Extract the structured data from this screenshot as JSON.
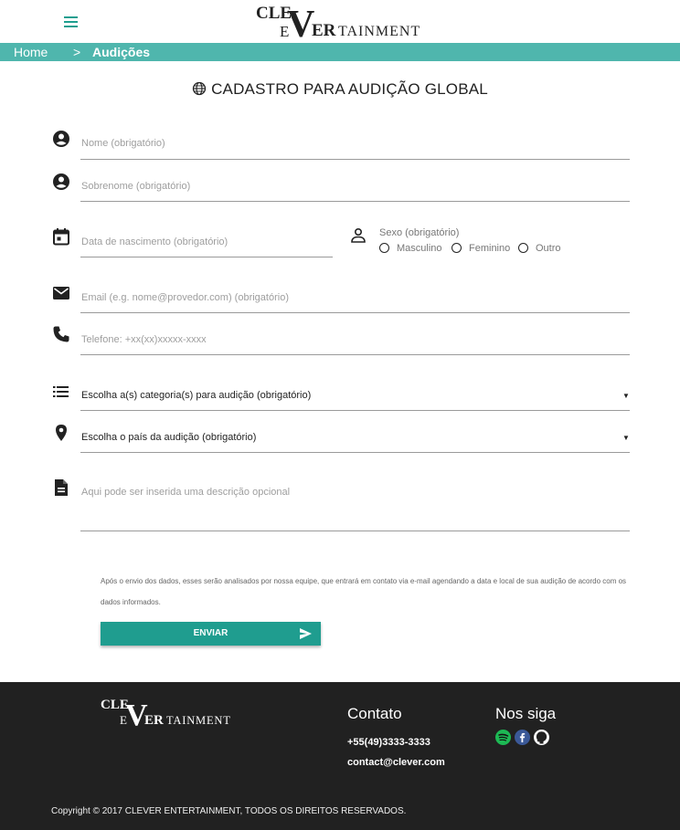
{
  "header": {
    "brand_top": "CLE",
    "brand_v": "V",
    "brand_e": "E",
    "brand_er": "ER",
    "brand_rest": "TAINMENT"
  },
  "breadcrumb": {
    "home": "Home",
    "separator": ">",
    "current": "Audições"
  },
  "page_title": "CADASTRO PARA AUDIÇÃO GLOBAL",
  "form": {
    "first_name_placeholder": "Nome (obrigatório)",
    "last_name_placeholder": "Sobrenome (obrigatório)",
    "birthdate_placeholder": "Data de nascimento (obrigatório)",
    "gender": {
      "legend": "Sexo (obrigatório)",
      "options": [
        "Masculino",
        "Feminino",
        "Outro"
      ]
    },
    "email_placeholder": "Email (e.g. nome@provedor.com) (obrigatório)",
    "phone_placeholder": "Telefone: +xx(xx)xxxxx-xxxx",
    "category_select": "Escolha a(s) categoria(s) para audição (obrigatório)",
    "country_select": "Escolha o país da audição (obrigatório)",
    "description_placeholder": "Aqui pode ser inserida uma descrição opcional",
    "caret": "▼",
    "note": "Após o envio dos dados, esses serão analisados por nossa equipe, que entrará em contato via e-mail agendando a data e local de sua audição de acordo com os dados informados.",
    "submit_label": "ENVIAR"
  },
  "footer": {
    "contact_title": "Contato",
    "phone": "+55(49)3333-3333",
    "email": "contact@clever.com",
    "follow_title": "Nos siga",
    "social_icons": [
      "spotify-icon",
      "facebook-icon",
      "github-icon"
    ],
    "copyright": "Copyright © 2017 CLEVER ENTERTAINMENT, TODOS OS DIREITOS RESERVADOS."
  },
  "colors": {
    "accent": "#4fb6ad",
    "button": "#1f9d8f",
    "footer_bg": "#212121",
    "spotify": "#1db954",
    "facebook": "#3b5998"
  }
}
